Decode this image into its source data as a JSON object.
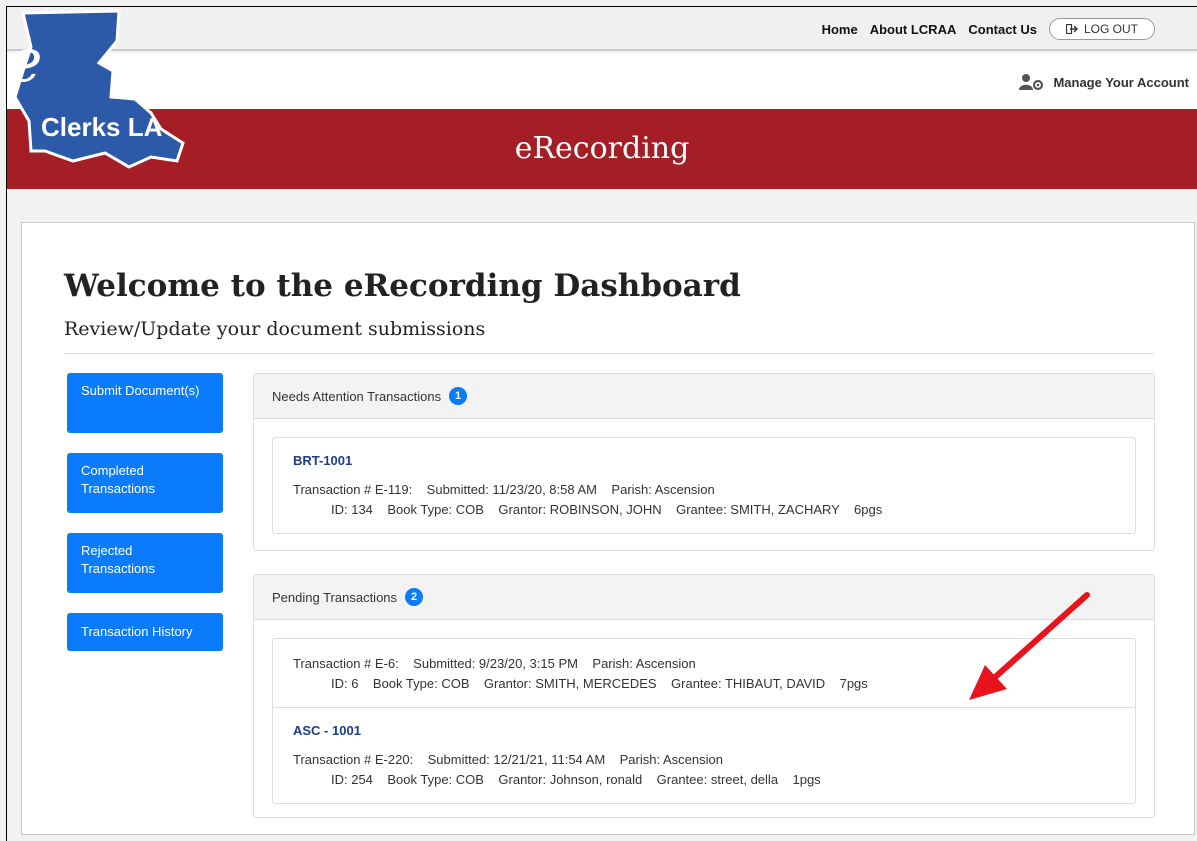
{
  "topnav": {
    "home": "Home",
    "about": "About LCRAA",
    "contact": "Contact Us",
    "logout": "LOG OUT"
  },
  "account": {
    "label": "Manage Your Account"
  },
  "logo": {
    "letter": "e",
    "text": "Clerks LA"
  },
  "banner": {
    "title": "eRecording"
  },
  "welcome": {
    "title": "Welcome to the eRecording Dashboard",
    "subtitle": "Review/Update your document submissions"
  },
  "sidebar": {
    "items": [
      {
        "label": "Submit Document(s)"
      },
      {
        "label": "Completed Transactions"
      },
      {
        "label": "Rejected Transactions"
      },
      {
        "label": "Transaction History"
      }
    ]
  },
  "needs_attention": {
    "title": "Needs Attention Transactions",
    "count": "1",
    "items": [
      {
        "link": "BRT-1001",
        "line1": "Transaction # E-119:    Submitted: 11/23/20, 8:58 AM    Parish: Ascension",
        "line2": "ID: 134    Book Type: COB    Grantor: ROBINSON, JOHN    Grantee: SMITH, ZACHARY    6pgs"
      }
    ]
  },
  "pending": {
    "title": "Pending Transactions",
    "count": "2",
    "items": [
      {
        "line1": "Transaction # E-6:    Submitted: 9/23/20, 3:15 PM    Parish: Ascension",
        "line2": "ID: 6    Book Type: COB    Grantor: SMITH, MERCEDES    Grantee: THIBAUT, DAVID    7pgs"
      },
      {
        "link": "ASC - 1001",
        "line1": "Transaction # E-220:    Submitted: 12/21/21, 11:54 AM    Parish: Ascension",
        "line2": "ID: 254    Book Type: COB    Grantor: Johnson, ronald    Grantee: street, della    1pgs"
      }
    ]
  },
  "colors": {
    "banner": "#a51d25",
    "primary": "#0a7cfb",
    "link": "#1d3c8c",
    "annotation_arrow": "#e8141c"
  }
}
